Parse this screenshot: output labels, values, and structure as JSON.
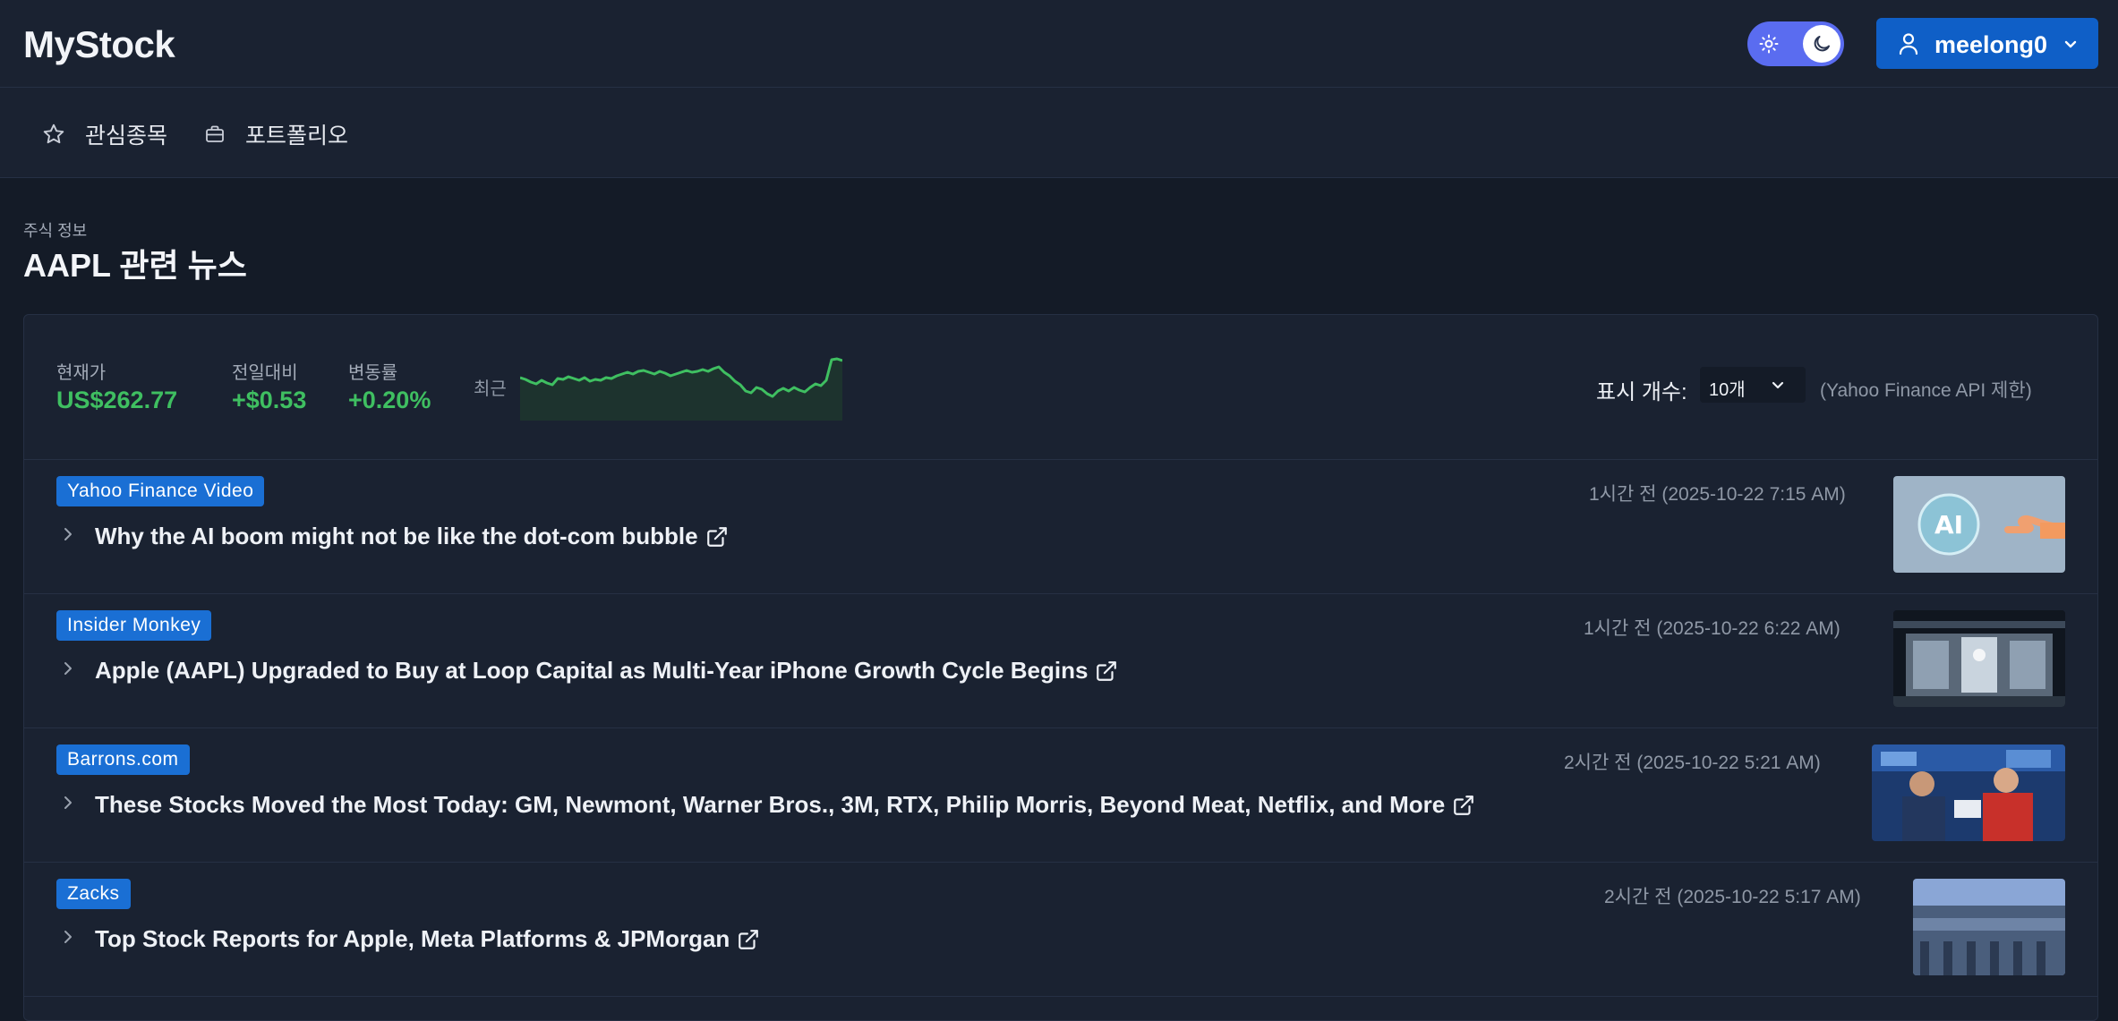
{
  "app": {
    "title": "MyStock"
  },
  "user": {
    "name": "meelong0"
  },
  "nav": {
    "items": [
      {
        "label": "관심종목",
        "icon": "star-icon"
      },
      {
        "label": "포트폴리오",
        "icon": "briefcase-icon"
      }
    ]
  },
  "page": {
    "subtitle": "주식 정보",
    "title": "AAPL 관련 뉴스"
  },
  "stats": {
    "current_label": "현재가",
    "current_value": "US$262.77",
    "change_label": "전일대비",
    "change_value": "+$0.53",
    "rate_label": "변동률",
    "rate_value": "+0.20%",
    "spark_label": "최근",
    "spark_color": "#3fbf61"
  },
  "display_count": {
    "label": "표시 개수:",
    "value": "10개",
    "note": "(Yahoo Finance API 제한)"
  },
  "news": [
    {
      "source": "Yahoo Finance Video",
      "title": "Why the AI boom might not be like the dot-com bubble",
      "ago": "1시간 전",
      "datetime": "(2025-10-22 7:15 AM)"
    },
    {
      "source": "Insider Monkey",
      "title": "Apple (AAPL) Upgraded to Buy at Loop Capital as Multi-Year iPhone Growth Cycle Begins",
      "ago": "1시간 전",
      "datetime": "(2025-10-22 6:22 AM)"
    },
    {
      "source": "Barrons.com",
      "title": "These Stocks Moved the Most Today: GM, Newmont, Warner Bros., 3M, RTX, Philip Morris, Beyond Meat, Netflix, and More",
      "ago": "2시간 전",
      "datetime": "(2025-10-22 5:21 AM)"
    },
    {
      "source": "Zacks",
      "title": "Top Stock Reports for Apple, Meta Platforms & JPMorgan",
      "ago": "2시간 전",
      "datetime": "(2025-10-22 5:17 AM)"
    }
  ],
  "colors": {
    "accent": "#1a6fd4",
    "positive": "#3fbf61",
    "toggle": "#5a6cf0"
  }
}
